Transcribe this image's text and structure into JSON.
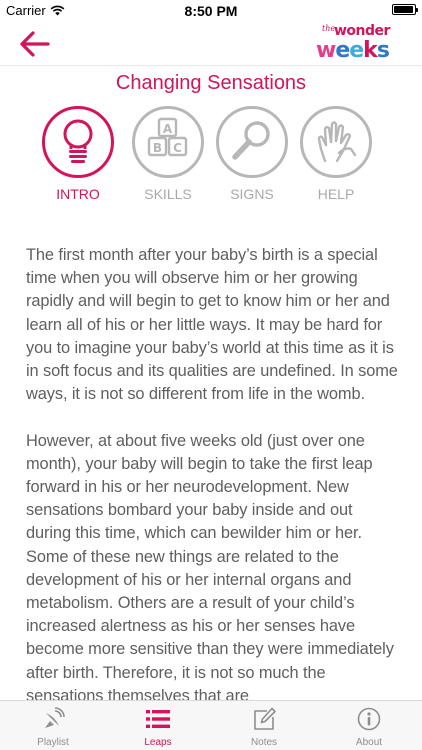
{
  "status_bar": {
    "carrier": "Carrier",
    "time": "8:50 PM",
    "icons": [
      "wifi-icon",
      "battery-icon"
    ]
  },
  "nav": {
    "back_icon": "back-arrow-icon",
    "logo": {
      "small": "the",
      "top": "wonder",
      "main": "weeks"
    }
  },
  "page_title": "Changing Sensations",
  "tabs": [
    {
      "label": "INTRO",
      "icon": "lightbulb-icon",
      "active": true
    },
    {
      "label": "SKILLS",
      "icon": "abc-blocks-icon",
      "active": false
    },
    {
      "label": "SIGNS",
      "icon": "magnifier-icon",
      "active": false
    },
    {
      "label": "HELP",
      "icon": "helping-hand-icon",
      "active": false
    }
  ],
  "content": {
    "paragraphs": [
      "The first month after your baby’s birth is a special time when you will observe him or her growing rapidly and will begin to get to know him or her and learn all of his or her little ways. It may be hard for you to imagine your baby’s world at this time as it is in soft focus and its qualities are undefined. In some ways, it is not so different from life in the womb.",
      "However, at about five weeks old (just over one month), your baby will begin to take the first leap forward in his or her neurodevelopment. New sensations bombard your baby inside and out during this time, which can bewilder him or her. Some of these new things are related to the development of his or her internal organs and metabolism. Others are a result of your child’s increased alertness as his or her senses have become more sensitive than they were immediately after birth. Therefore, it is not so much the sensations themselves that are"
    ]
  },
  "tab_bar": [
    {
      "label": "Playlist",
      "icon": "playlist-satellite-icon",
      "active": false
    },
    {
      "label": "Leaps",
      "icon": "list-icon",
      "active": true
    },
    {
      "label": "Notes",
      "icon": "pencil-note-icon",
      "active": false
    },
    {
      "label": "About",
      "icon": "info-icon",
      "active": false
    }
  ],
  "colors": {
    "accent": "#d2145a",
    "inactive": "#b7b7b7",
    "body_text": "#5f5f5f"
  }
}
